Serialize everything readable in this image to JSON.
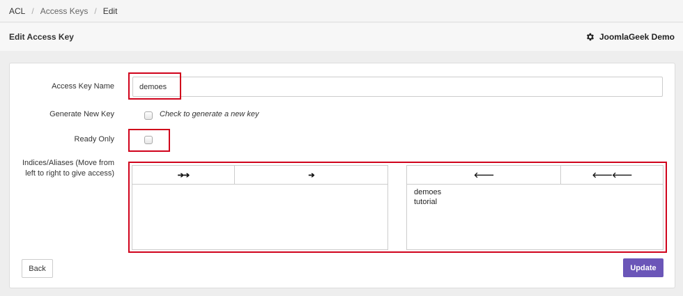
{
  "breadcrumb": {
    "items": [
      "ACL",
      "Access Keys",
      "Edit"
    ],
    "separator": "/"
  },
  "header": {
    "title": "Edit Access Key",
    "brand": "JoomlaGeek Demo",
    "brand_icon": "gear-icon"
  },
  "form": {
    "access_key_name_label": "Access Key Name",
    "access_key_name_value": "demoes",
    "generate_new_key_label": "Generate New Key",
    "generate_new_key_checked": false,
    "generate_new_key_hint": "Check to generate a new key",
    "read_only_label": "Ready Only",
    "read_only_checked": false,
    "indices_label": "Indices/Aliases (Move from left to right to give access)"
  },
  "lists": {
    "left": {
      "buttons": [
        "➔➔",
        "➔"
      ],
      "button_icons": [
        "move-all-right-icon",
        "move-right-icon"
      ],
      "items": []
    },
    "right": {
      "buttons": [
        "🡐",
        "🡐🡐"
      ],
      "button_icons": [
        "move-left-icon",
        "move-all-left-icon"
      ],
      "items": [
        "demoes",
        "tutorial"
      ]
    }
  },
  "actions": {
    "back_label": "Back",
    "update_label": "Update"
  },
  "colors": {
    "highlight": "#d0021b",
    "update_button": "#6b56b8"
  }
}
